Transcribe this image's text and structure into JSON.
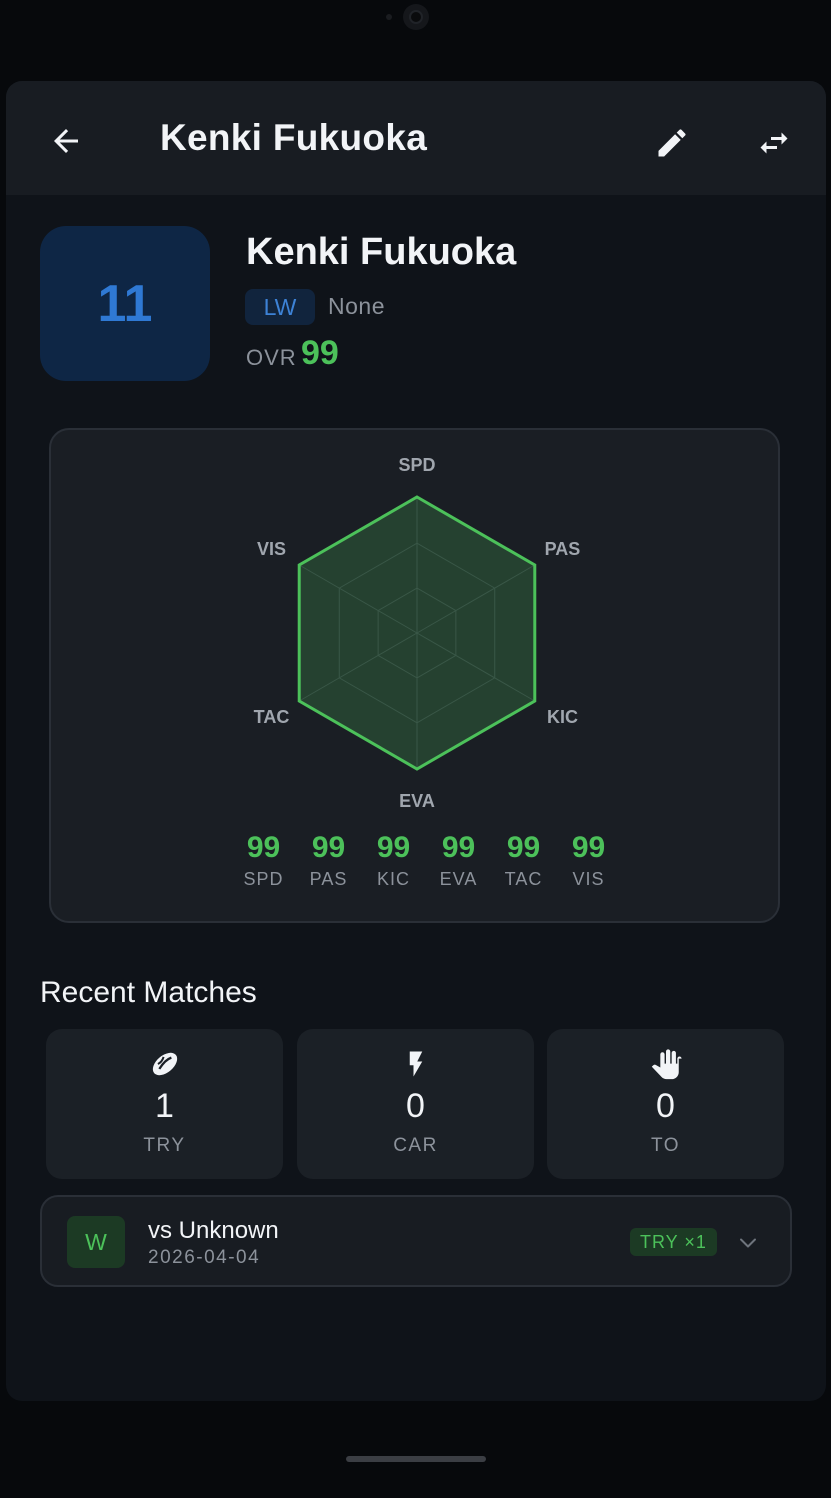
{
  "header": {
    "title": "Kenki Fukuoka"
  },
  "player": {
    "number": "11",
    "name": "Kenki Fukuoka",
    "position": "LW",
    "team": "None",
    "ovr_label": "OVR",
    "ovr_value": "99"
  },
  "chart_data": {
    "type": "radar",
    "axes": [
      "SPD",
      "PAS",
      "KIC",
      "EVA",
      "TAC",
      "VIS"
    ],
    "values": [
      99,
      99,
      99,
      99,
      99,
      99
    ],
    "range": [
      0,
      99
    ],
    "color": "#4cc15a"
  },
  "stats": [
    {
      "value": "99",
      "label": "SPD"
    },
    {
      "value": "99",
      "label": "PAS"
    },
    {
      "value": "99",
      "label": "KIC"
    },
    {
      "value": "99",
      "label": "EVA"
    },
    {
      "value": "99",
      "label": "TAC"
    },
    {
      "value": "99",
      "label": "VIS"
    }
  ],
  "recent": {
    "title": "Recent Matches",
    "summary": [
      {
        "icon": "rugby-ball-icon",
        "value": "1",
        "label": "TRY"
      },
      {
        "icon": "lightning-icon",
        "value": "0",
        "label": "CAR"
      },
      {
        "icon": "hand-icon",
        "value": "0",
        "label": "TO"
      }
    ],
    "matches": [
      {
        "result": "W",
        "opponent": "vs Unknown",
        "date": "2026-04-04",
        "chip": "TRY ×1"
      }
    ]
  },
  "colors": {
    "accent_green": "#4cc15a",
    "accent_blue": "#2f79d4"
  }
}
